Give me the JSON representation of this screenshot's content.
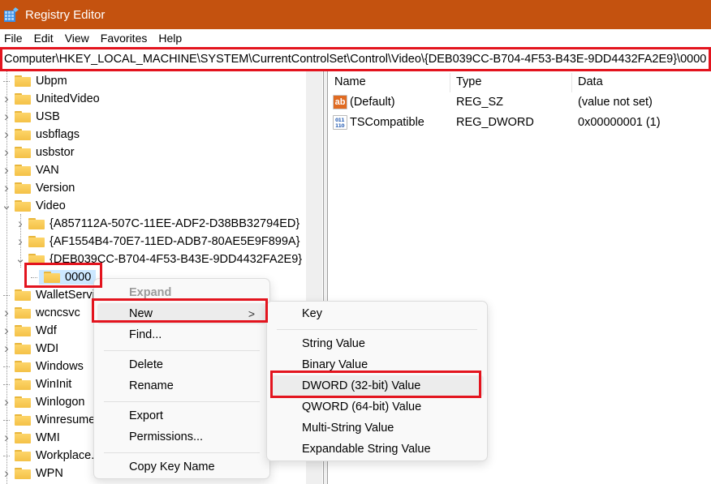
{
  "window": {
    "title": "Registry Editor",
    "app_icon": "registry-editor-icon",
    "title_bar_color": "#c4520f"
  },
  "menu": [
    "File",
    "Edit",
    "View",
    "Favorites",
    "Help"
  ],
  "address_bar": {
    "path": "Computer\\HKEY_LOCAL_MACHINE\\SYSTEM\\CurrentControlSet\\Control\\Video\\{DEB039CC-B704-4F53-B43E-9DD4432FA2E9}\\0000"
  },
  "tree": {
    "items": [
      {
        "label": "Ubpm",
        "level": 0,
        "expander": "none"
      },
      {
        "label": "UnitedVideo",
        "level": 0,
        "expander": "collapsed"
      },
      {
        "label": "USB",
        "level": 0,
        "expander": "collapsed"
      },
      {
        "label": "usbflags",
        "level": 0,
        "expander": "collapsed"
      },
      {
        "label": "usbstor",
        "level": 0,
        "expander": "collapsed"
      },
      {
        "label": "VAN",
        "level": 0,
        "expander": "collapsed"
      },
      {
        "label": "Version",
        "level": 0,
        "expander": "collapsed"
      },
      {
        "label": "Video",
        "level": 0,
        "expander": "expanded"
      },
      {
        "label": "{A857112A-507C-11EE-ADF2-D38BB32794ED}",
        "level": 1,
        "expander": "collapsed"
      },
      {
        "label": "{AF1554B4-70E7-11ED-ADB7-80AE5E9F899A}",
        "level": 1,
        "expander": "collapsed"
      },
      {
        "label": "{DEB039CC-B704-4F53-B43E-9DD4432FA2E9}",
        "level": 1,
        "expander": "expanded"
      },
      {
        "label": "0000",
        "level": 2,
        "expander": "none",
        "selected": true
      },
      {
        "label": "WalletService",
        "level": 0,
        "expander": "none"
      },
      {
        "label": "wcncsvc",
        "level": 0,
        "expander": "collapsed"
      },
      {
        "label": "Wdf",
        "level": 0,
        "expander": "collapsed"
      },
      {
        "label": "WDI",
        "level": 0,
        "expander": "collapsed"
      },
      {
        "label": "Windows",
        "level": 0,
        "expander": "none"
      },
      {
        "label": "WinInit",
        "level": 0,
        "expander": "none"
      },
      {
        "label": "Winlogon",
        "level": 0,
        "expander": "collapsed"
      },
      {
        "label": "Winresume",
        "level": 0,
        "expander": "none"
      },
      {
        "label": "WMI",
        "level": 0,
        "expander": "collapsed"
      },
      {
        "label": "Workplace...",
        "level": 0,
        "expander": "none"
      },
      {
        "label": "WPN",
        "level": 0,
        "expander": "collapsed"
      }
    ]
  },
  "values_pane": {
    "columns": [
      "Name",
      "Type",
      "Data"
    ],
    "rows": [
      {
        "icon": "string-value-icon",
        "icon_text": "ab",
        "name": "(Default)",
        "type": "REG_SZ",
        "data": "(value not set)"
      },
      {
        "icon": "binary-value-icon",
        "icon_text": "011\n110",
        "name": "TSCompatible",
        "type": "REG_DWORD",
        "data": "0x00000001 (1)"
      }
    ]
  },
  "context_menu": {
    "items": [
      {
        "label": "Expand",
        "disabled": true
      },
      {
        "label": "New",
        "submenu": true,
        "highlighted": true
      },
      {
        "label": "Find..."
      },
      {
        "separator": true
      },
      {
        "label": "Delete"
      },
      {
        "label": "Rename"
      },
      {
        "separator": true
      },
      {
        "label": "Export"
      },
      {
        "label": "Permissions..."
      },
      {
        "separator": true
      },
      {
        "label": "Copy Key Name"
      }
    ],
    "submenu_arrow": ">"
  },
  "new_submenu": {
    "items": [
      {
        "label": "Key"
      },
      {
        "separator": true
      },
      {
        "label": "String Value"
      },
      {
        "label": "Binary Value"
      },
      {
        "label": "DWORD (32-bit) Value",
        "highlighted": true
      },
      {
        "label": "QWORD (64-bit) Value"
      },
      {
        "label": "Multi-String Value"
      },
      {
        "label": "Expandable String Value"
      }
    ]
  },
  "annotation_color": "#e3141e"
}
